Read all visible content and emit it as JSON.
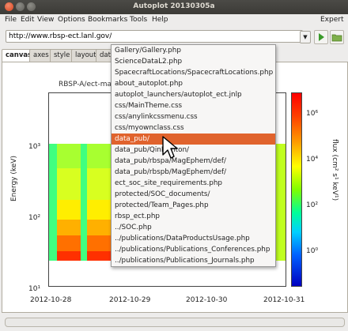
{
  "window": {
    "title": "Autoplot 20130305a"
  },
  "menubar": {
    "items": [
      "File",
      "Edit",
      "View",
      "Options",
      "Bookmarks",
      "Tools",
      "Help"
    ],
    "expert": "Expert"
  },
  "url_bar": {
    "value": "http://www.rbsp-ect.lanl.gov/"
  },
  "tabs": [
    "canvas",
    "axes",
    "style",
    "layout",
    "data"
  ],
  "plot": {
    "title": "RBSP-A/ect-ma",
    "ylabel": "Energy (keV)",
    "zlabel": "flux (cm² s¹ keV¹)",
    "y_ticks": [
      "10³",
      "10²",
      "10¹"
    ],
    "x_ticks": [
      "2012-10-28",
      "2012-10-29",
      "2012-10-30",
      "2012-10-31"
    ],
    "colorbar_ticks": [
      "10⁶",
      "10⁴",
      "10²",
      "10⁰"
    ]
  },
  "dropdown": {
    "items": [
      "Gallery/Gallery.php",
      "ScienceDataL2.php",
      "SpacecraftLocations/SpacecraftLocations.php",
      "about_autoplot.php",
      "autoplot_launchers/autoplot_ect.jnlp",
      "css/MainTheme.css",
      "css/anylinkcssmenu.css",
      "css/myownclass.css",
      "data_pub/",
      "data_pub/QinDenton/",
      "data_pub/rbspa/MagEphem/def/",
      "data_pub/rbspb/MagEphem/def/",
      "ect_soc_site_requirements.php",
      "protected/SOC_documents/",
      "protected/Team_Pages.php",
      "rbsp_ect.php",
      "../SOC.php",
      "../publications/DataProductsUsage.php",
      "../publications/Publications_Conferences.php",
      "../publications/Publications_Journals.php"
    ],
    "selected_index": 8
  }
}
